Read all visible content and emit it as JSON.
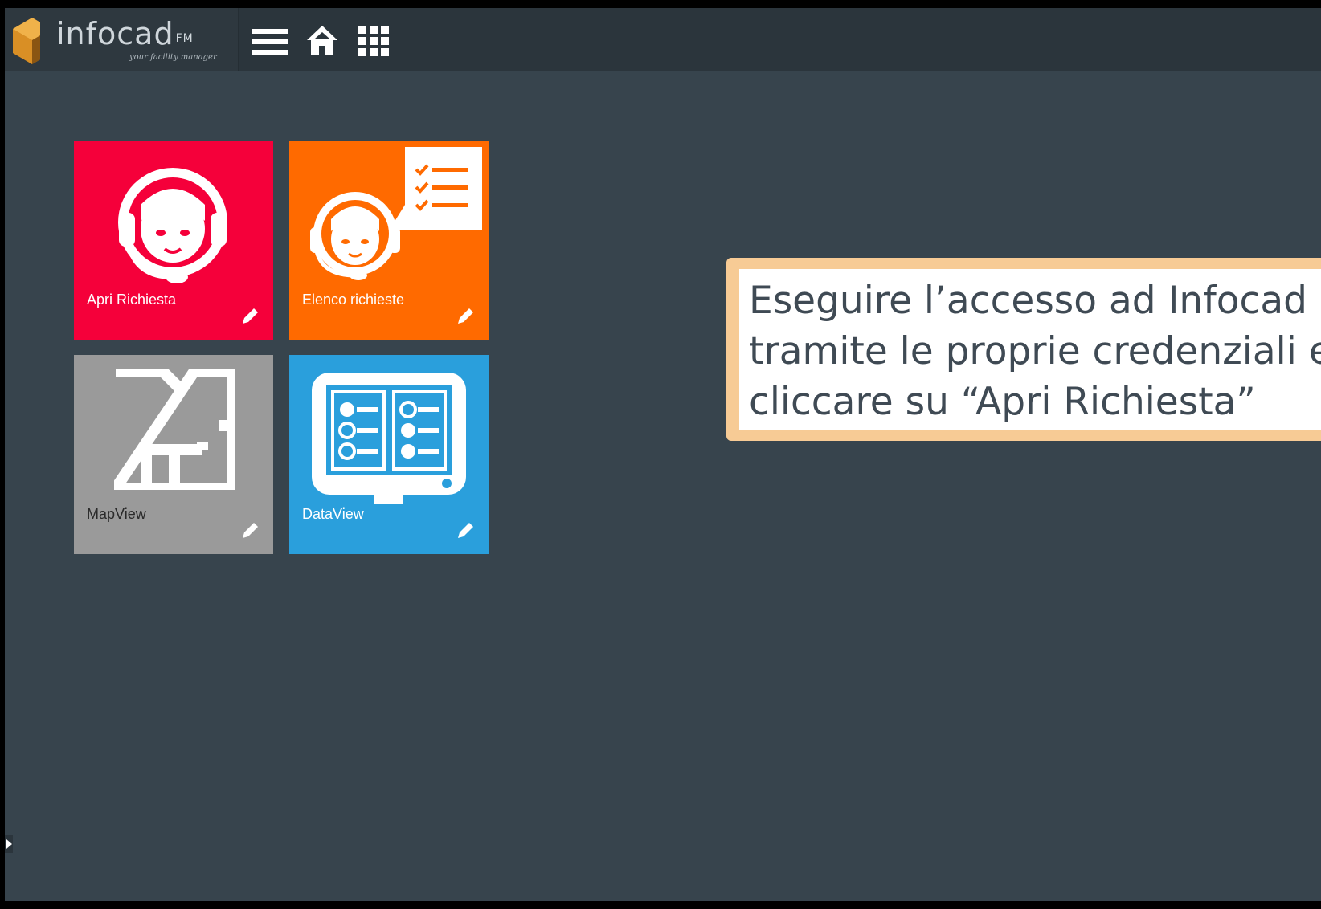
{
  "app": {
    "logo_text": "infocad",
    "logo_superscript": "FM",
    "logo_tagline": "your facility manager"
  },
  "toolbar": {
    "menu_icon": "hamburger-menu-icon",
    "home_icon": "home-icon",
    "apps_icon": "grid-apps-icon"
  },
  "tiles": [
    {
      "label": "Apri Richiesta",
      "color": "#f5003a",
      "icon": "operator-headset-icon"
    },
    {
      "label": "Elenco richieste",
      "color": "#ff6a00",
      "icon": "operator-checklist-icon"
    },
    {
      "label": "MapView",
      "color": "#9a9a9a",
      "icon": "floor-plan-icon"
    },
    {
      "label": "DataView",
      "color": "#2a9fdc",
      "icon": "data-panel-icon"
    }
  ],
  "callout": {
    "text": "Eseguire l’accesso ad Infocad\ntramite le proprie credenziali e\ncliccare su “Apri Richiesta”",
    "border_color": "#f7cb95"
  },
  "colors": {
    "background": "#37444d",
    "topbar": "#2b353c"
  }
}
